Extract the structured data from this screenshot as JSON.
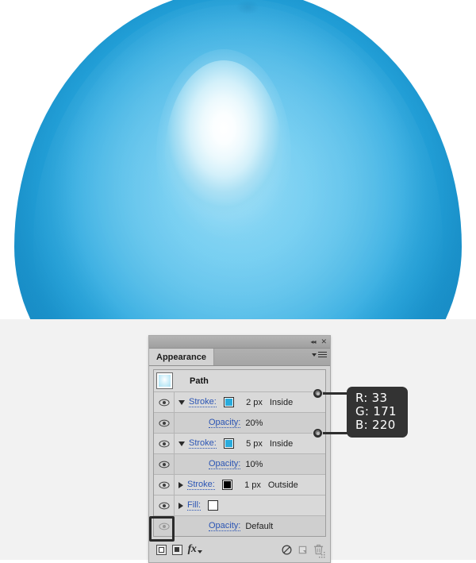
{
  "artwork": {
    "description": "blue egg shaped vector illustration with white highlight",
    "base_color": "#35b0e4",
    "highlight_color": "#ffffff",
    "edge_color": "#1f93ca"
  },
  "panel": {
    "titlebar": {
      "collapse_icon": "collapse-to-icons-icon",
      "collapse_glyph": "◂◂",
      "close_icon": "close-icon",
      "close_glyph": "✕"
    },
    "tab_label": "Appearance",
    "menu_icon": "panel-menu-icon",
    "path_row": {
      "thumbnail": "path-thumbnail",
      "label": "Path"
    },
    "rows": [
      {
        "type": "stroke",
        "visible": true,
        "expanded": true,
        "label": "Stroke:",
        "swatch": "blue",
        "swatch_color": "#29abdc",
        "width": "2 px",
        "align": "Inside"
      },
      {
        "type": "opacity",
        "visible": true,
        "label": "Opacity:",
        "value": "20%"
      },
      {
        "type": "stroke",
        "visible": true,
        "expanded": true,
        "label": "Stroke:",
        "swatch": "blue",
        "swatch_color": "#29abdc",
        "width": "5 px",
        "align": "Inside"
      },
      {
        "type": "opacity",
        "visible": true,
        "label": "Opacity:",
        "value": "10%"
      },
      {
        "type": "stroke",
        "visible": true,
        "expanded": false,
        "label": "Stroke:",
        "swatch": "black",
        "swatch_color": "#000000",
        "width": "1 px",
        "align": "Outside"
      },
      {
        "type": "fill",
        "visible": true,
        "expanded": false,
        "label": "Fill:",
        "swatch": "white",
        "swatch_color": "#ffffff",
        "width": "",
        "align": ""
      },
      {
        "type": "opacity",
        "visible": false,
        "label": "Opacity:",
        "value": "Default"
      }
    ],
    "bottombar": {
      "add_new_stroke": "add-new-stroke-button",
      "add_new_fill": "add-new-fill-button",
      "fx_label": "fx",
      "clear_appearance": "clear-appearance-button",
      "duplicate_item": "duplicate-item-button",
      "delete_item": "delete-item-button",
      "resize_grip": "resize-grip"
    }
  },
  "callout": {
    "r_line": "R: 33",
    "g_line": "G: 171",
    "b_line": "B: 220",
    "r": 33,
    "g": 171,
    "b": 220,
    "hex": "#21abdc",
    "background": "#333333",
    "text_color": "#ffffff"
  }
}
